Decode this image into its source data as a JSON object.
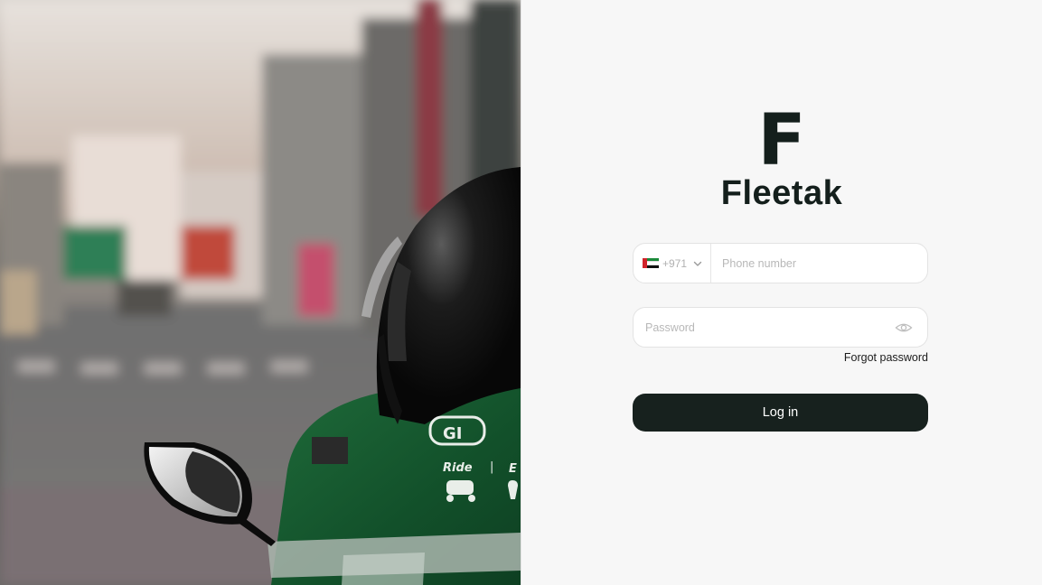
{
  "brand": {
    "mark": "F",
    "name": "Fleetak"
  },
  "phone": {
    "country_flag": "uae-flag-icon",
    "dial_code": "+971",
    "placeholder": "Phone number"
  },
  "password": {
    "placeholder": "Password",
    "toggle_icon": "eye-icon"
  },
  "links": {
    "forgot_password": "Forgot password"
  },
  "actions": {
    "login_label": "Log in"
  },
  "hero": {
    "jacket_logo": "GI",
    "jacket_text_ride": "Ride",
    "jacket_text_divider": "|",
    "jacket_text_partial": "E"
  },
  "colors": {
    "primary": "#17211e",
    "background": "#f7f7f7",
    "jacket_green": "#1f7a3e"
  }
}
